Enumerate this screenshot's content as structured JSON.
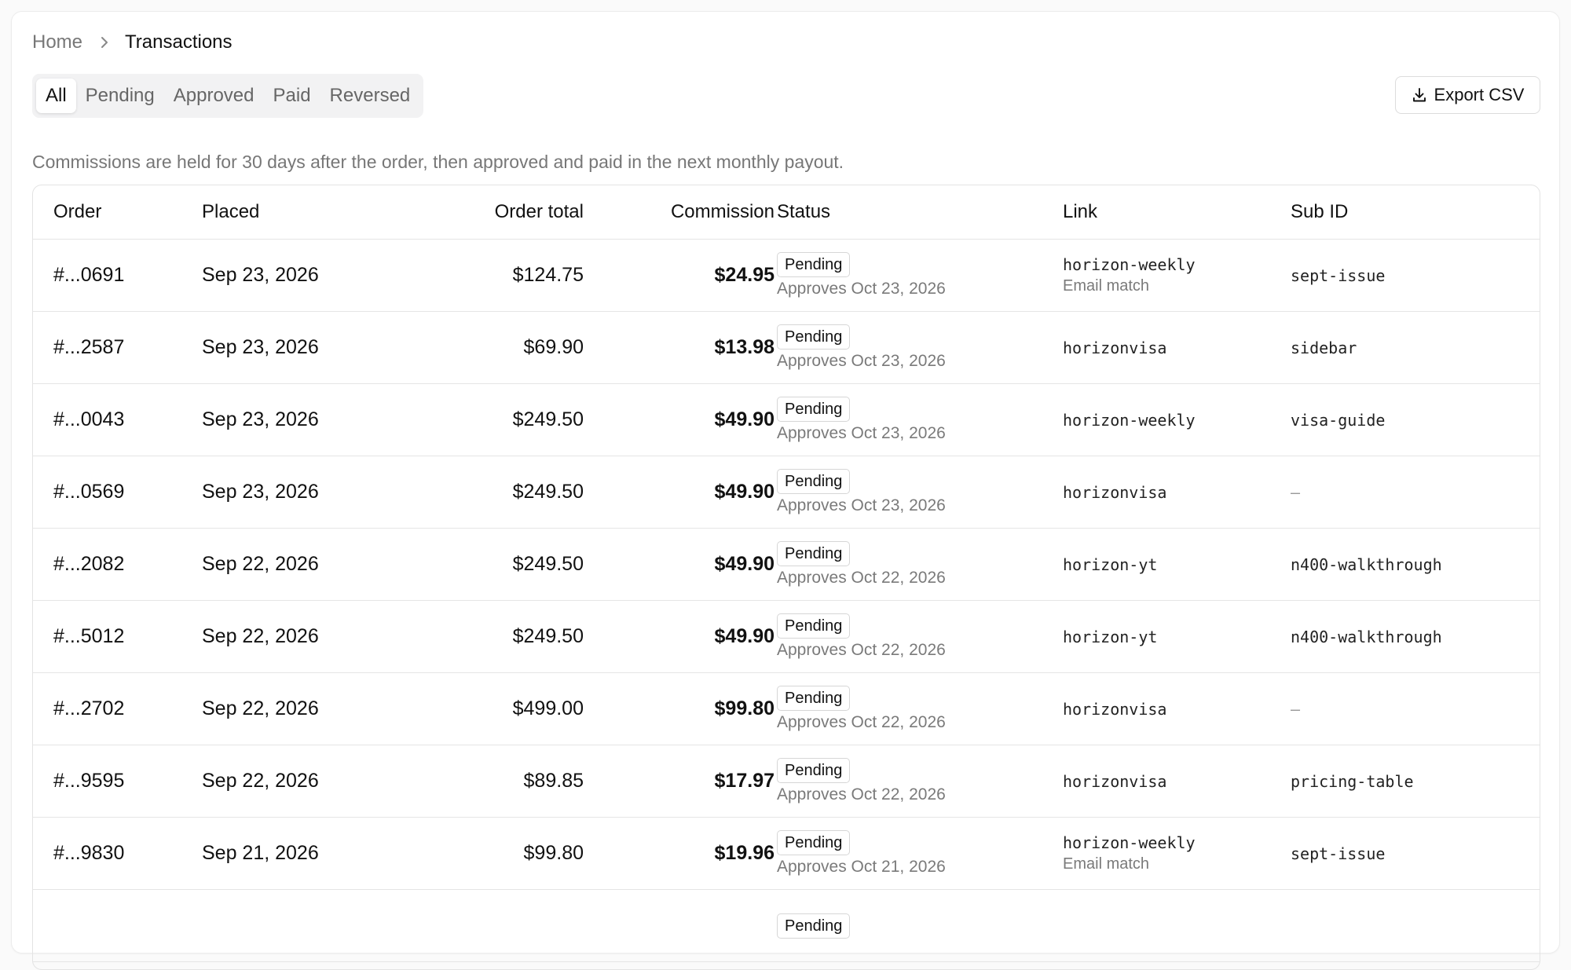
{
  "breadcrumb": {
    "home": "Home",
    "current": "Transactions"
  },
  "tabs": [
    {
      "label": "All",
      "active": true
    },
    {
      "label": "Pending",
      "active": false
    },
    {
      "label": "Approved",
      "active": false
    },
    {
      "label": "Paid",
      "active": false
    },
    {
      "label": "Reversed",
      "active": false
    }
  ],
  "export": {
    "label": "Export CSV",
    "icon": "download-icon"
  },
  "note": "Commissions are held for 30 days after the order, then approved and paid in the next monthly payout.",
  "table": {
    "headers": {
      "order": "Order",
      "placed": "Placed",
      "total": "Order total",
      "commission": "Commission",
      "status": "Status",
      "link": "Link",
      "sub_id": "Sub ID"
    },
    "rows": [
      {
        "order": "#...0691",
        "placed": "Sep 23, 2026",
        "total": "$124.75",
        "commission": "$24.95",
        "status": "Pending",
        "approves": "Approves Oct 23, 2026",
        "link": "horizon-weekly",
        "link_note": "Email match",
        "sub_id": "sept-issue"
      },
      {
        "order": "#...2587",
        "placed": "Sep 23, 2026",
        "total": "$69.90",
        "commission": "$13.98",
        "status": "Pending",
        "approves": "Approves Oct 23, 2026",
        "link": "horizonvisa",
        "link_note": "",
        "sub_id": "sidebar"
      },
      {
        "order": "#...0043",
        "placed": "Sep 23, 2026",
        "total": "$249.50",
        "commission": "$49.90",
        "status": "Pending",
        "approves": "Approves Oct 23, 2026",
        "link": "horizon-weekly",
        "link_note": "",
        "sub_id": "visa-guide"
      },
      {
        "order": "#...0569",
        "placed": "Sep 23, 2026",
        "total": "$249.50",
        "commission": "$49.90",
        "status": "Pending",
        "approves": "Approves Oct 23, 2026",
        "link": "horizonvisa",
        "link_note": "",
        "sub_id": "—"
      },
      {
        "order": "#...2082",
        "placed": "Sep 22, 2026",
        "total": "$249.50",
        "commission": "$49.90",
        "status": "Pending",
        "approves": "Approves Oct 22, 2026",
        "link": "horizon-yt",
        "link_note": "",
        "sub_id": "n400-walkthrough"
      },
      {
        "order": "#...5012",
        "placed": "Sep 22, 2026",
        "total": "$249.50",
        "commission": "$49.90",
        "status": "Pending",
        "approves": "Approves Oct 22, 2026",
        "link": "horizon-yt",
        "link_note": "",
        "sub_id": "n400-walkthrough"
      },
      {
        "order": "#...2702",
        "placed": "Sep 22, 2026",
        "total": "$499.00",
        "commission": "$99.80",
        "status": "Pending",
        "approves": "Approves Oct 22, 2026",
        "link": "horizonvisa",
        "link_note": "",
        "sub_id": "—"
      },
      {
        "order": "#...9595",
        "placed": "Sep 22, 2026",
        "total": "$89.85",
        "commission": "$17.97",
        "status": "Pending",
        "approves": "Approves Oct 22, 2026",
        "link": "horizonvisa",
        "link_note": "",
        "sub_id": "pricing-table"
      },
      {
        "order": "#...9830",
        "placed": "Sep 21, 2026",
        "total": "$99.80",
        "commission": "$19.96",
        "status": "Pending",
        "approves": "Approves Oct 21, 2026",
        "link": "horizon-weekly",
        "link_note": "Email match",
        "sub_id": "sept-issue"
      },
      {
        "order": "",
        "placed": "",
        "total": "",
        "commission": "",
        "status": "Pending",
        "approves": "",
        "link": "",
        "link_note": "",
        "sub_id": ""
      }
    ]
  },
  "colors": {
    "text": "#111111",
    "muted": "#777777",
    "border": "#e5e5e5",
    "tabs_bg": "#f2f2f3"
  }
}
